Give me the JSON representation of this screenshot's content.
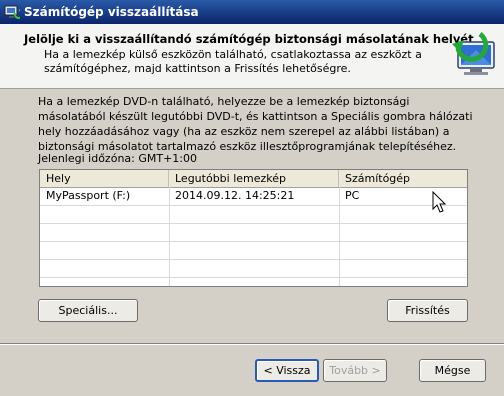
{
  "window": {
    "title": "Számítógép visszaállítása"
  },
  "header": {
    "title": "Jelölje ki a visszaállítandó számítógép biztonsági másolatának helyét",
    "subtitle": "Ha a lemezkép külső eszközön található, csatlakoztassa az eszközt a számítógéphez, majd kattintson a Frissítés lehetőségre."
  },
  "body": {
    "description": "Ha a lemezkép DVD-n található, helyezze be a lemezkép biztonsági másolatából készült legutóbbi DVD-t, és kattintson a Speciális gombra hálózati hely hozzáadásához vagy (ha az eszköz nem szerepel az alábbi listában) a biztonsági másolatot tartalmazó eszköz illesztőprogramjának telepítéséhez.",
    "timezone": "Jelenlegi időzóna: GMT+1:00"
  },
  "table": {
    "columns": [
      "Hely",
      "Legutóbbi lemezkép",
      "Számítógép"
    ],
    "rows": [
      [
        "MyPassport (F:)",
        "2014.09.12. 14:25:21",
        "PC"
      ]
    ]
  },
  "buttons": {
    "advanced": "Speciális...",
    "refresh": "Frissítés",
    "back": "< Vissza",
    "next": "Tovább >",
    "cancel": "Mégse"
  }
}
